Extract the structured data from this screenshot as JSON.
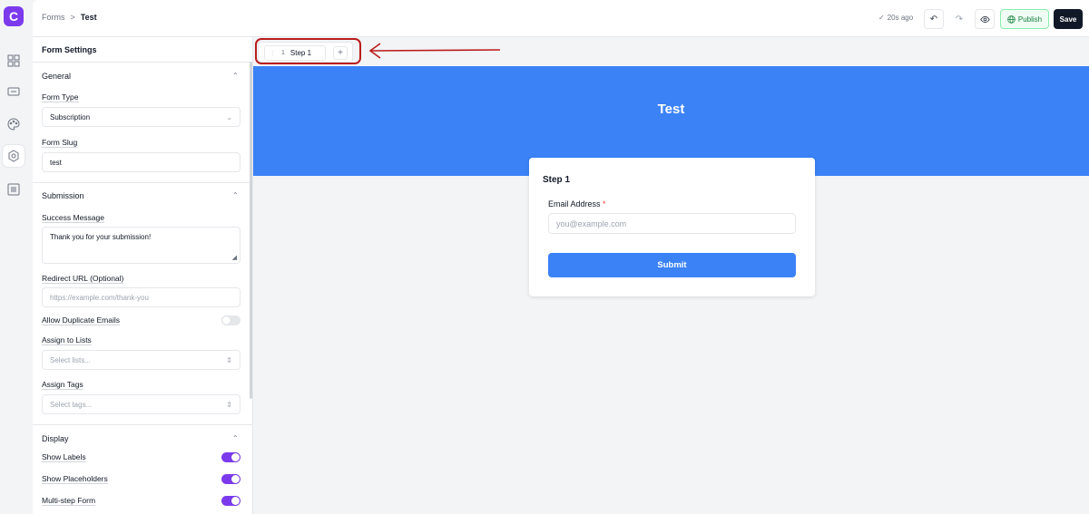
{
  "colors": {
    "brand": "#7c3aed",
    "banner": "#3b82f6",
    "annotation": "#b91c1c",
    "publish": "#15803d"
  },
  "rail": {
    "logo_icon": "c-logo-icon",
    "items": [
      "grid-icon",
      "card-icon",
      "palette-icon",
      "settings-icon",
      "columns-icon"
    ]
  },
  "topbar": {
    "breadcrumb_root": "Forms",
    "breadcrumb_sep": ">",
    "breadcrumb_current": "Test",
    "saved_status": "20s ago",
    "publish_label": "Publish",
    "save_label": "Save"
  },
  "sidebar": {
    "title": "Form Settings",
    "general": {
      "title": "General",
      "form_type_label": "Form Type",
      "form_type_value": "Subscription",
      "form_slug_label": "Form Slug",
      "form_slug_value": "test"
    },
    "submission": {
      "title": "Submission",
      "success_label": "Success Message",
      "success_value": "Thank you for your submission!",
      "redirect_label": "Redirect URL (Optional)",
      "redirect_placeholder": "https://example.com/thank-you",
      "duplicate_label": "Allow Duplicate Emails",
      "duplicate_on": false,
      "lists_label": "Assign to Lists",
      "lists_placeholder": "Select lists...",
      "tags_label": "Assign Tags",
      "tags_placeholder": "Select tags..."
    },
    "display": {
      "title": "Display",
      "show_labels": "Show Labels",
      "show_labels_on": true,
      "show_placeholders": "Show Placeholders",
      "show_placeholders_on": true,
      "multi_step": "Multi-step Form",
      "multi_step_on": true
    }
  },
  "canvas": {
    "step_number": "1",
    "step_label": "Step 1",
    "add_step": "+",
    "banner_title": "Test",
    "card_title": "Step 1",
    "email_label": "Email Address",
    "required_mark": "*",
    "email_placeholder": "you@example.com",
    "submit_label": "Submit"
  }
}
